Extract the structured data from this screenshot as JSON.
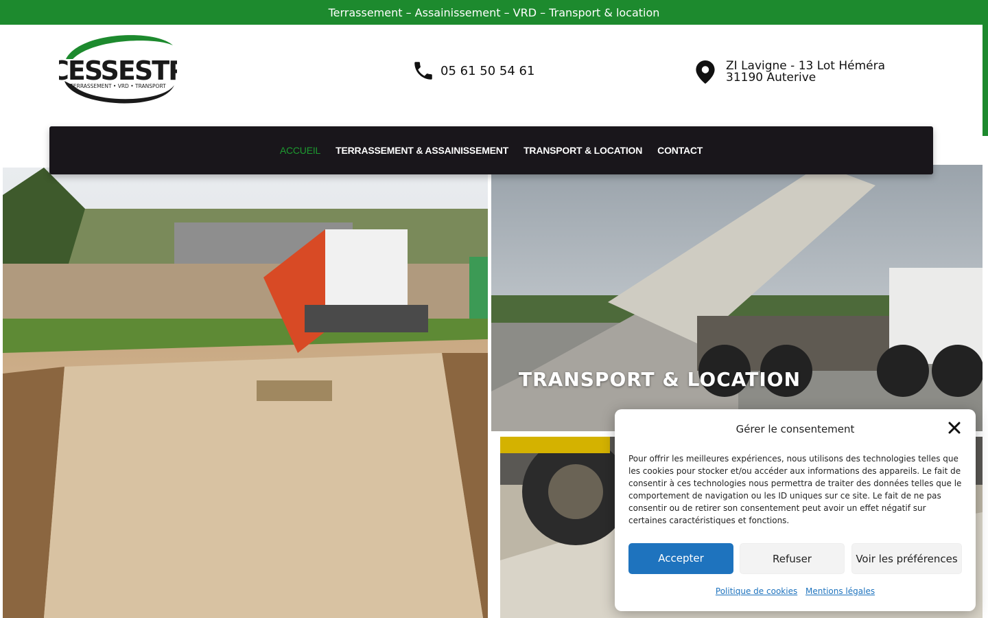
{
  "topbar": {
    "tagline": "Terrassement – Assainissement  – VRD – Transport & location"
  },
  "logo": {
    "name": "CESSESTP",
    "subtitle": "TERRASSEMENT • VRD • TRANSPORT"
  },
  "contact": {
    "phone": "05 61 50 54 61",
    "address": "ZI Lavigne - 13 Lot Héméra 31190 Auterive"
  },
  "nav": {
    "items": [
      {
        "label": "ACCUEIL",
        "active": true
      },
      {
        "label": "TERRASSEMENT & ASSAINISSEMENT",
        "active": false
      },
      {
        "label": "TRANSPORT & LOCATION",
        "active": false
      },
      {
        "label": "CONTACT",
        "active": false
      }
    ]
  },
  "hero": {
    "overlay_title": "TRANSPORT & LOCATION"
  },
  "consent": {
    "title": "Gérer le consentement",
    "body": "Pour offrir les meilleures expériences, nous utilisons des technologies telles que les cookies pour stocker et/ou accéder aux informations des appareils. Le fait de consentir à ces technologies nous permettra de traiter des données telles que le comportement de navigation ou les ID uniques sur ce site. Le fait de ne pas consentir ou de retirer son consentement peut avoir un effet négatif sur certaines caractéristiques et fonctions.",
    "accept_label": "Accepter",
    "refuse_label": "Refuser",
    "prefs_label": "Voir les préférences",
    "links": [
      "Politique de cookies",
      "Mentions légales"
    ]
  },
  "colors": {
    "brand_green": "#1d8a2e",
    "nav_bg": "#19161b",
    "accept_blue": "#1e73be"
  }
}
